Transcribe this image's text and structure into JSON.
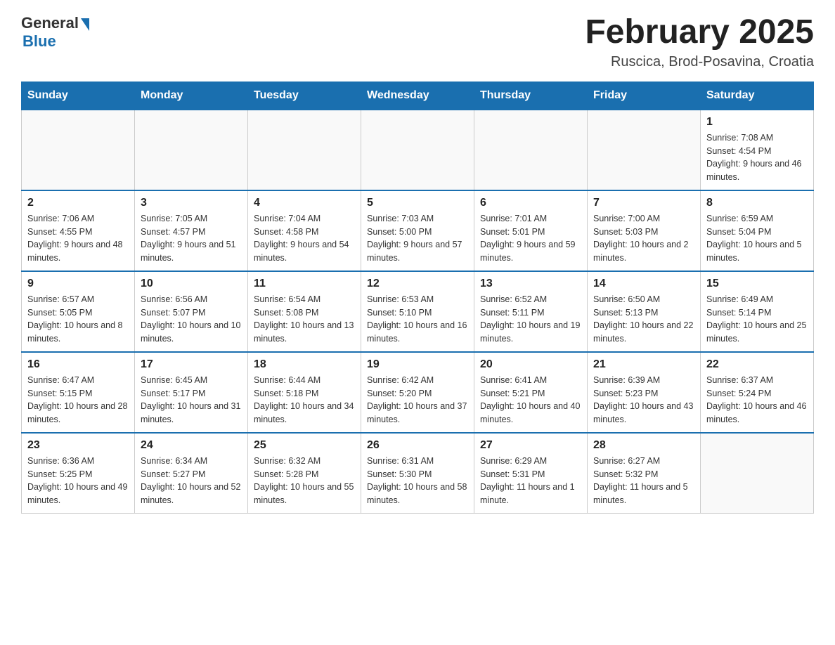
{
  "header": {
    "logo_general": "General",
    "logo_blue": "Blue",
    "month_title": "February 2025",
    "location": "Ruscica, Brod-Posavina, Croatia"
  },
  "days_of_week": [
    "Sunday",
    "Monday",
    "Tuesday",
    "Wednesday",
    "Thursday",
    "Friday",
    "Saturday"
  ],
  "weeks": [
    [
      {
        "day": "",
        "info": ""
      },
      {
        "day": "",
        "info": ""
      },
      {
        "day": "",
        "info": ""
      },
      {
        "day": "",
        "info": ""
      },
      {
        "day": "",
        "info": ""
      },
      {
        "day": "",
        "info": ""
      },
      {
        "day": "1",
        "info": "Sunrise: 7:08 AM\nSunset: 4:54 PM\nDaylight: 9 hours and 46 minutes."
      }
    ],
    [
      {
        "day": "2",
        "info": "Sunrise: 7:06 AM\nSunset: 4:55 PM\nDaylight: 9 hours and 48 minutes."
      },
      {
        "day": "3",
        "info": "Sunrise: 7:05 AM\nSunset: 4:57 PM\nDaylight: 9 hours and 51 minutes."
      },
      {
        "day": "4",
        "info": "Sunrise: 7:04 AM\nSunset: 4:58 PM\nDaylight: 9 hours and 54 minutes."
      },
      {
        "day": "5",
        "info": "Sunrise: 7:03 AM\nSunset: 5:00 PM\nDaylight: 9 hours and 57 minutes."
      },
      {
        "day": "6",
        "info": "Sunrise: 7:01 AM\nSunset: 5:01 PM\nDaylight: 9 hours and 59 minutes."
      },
      {
        "day": "7",
        "info": "Sunrise: 7:00 AM\nSunset: 5:03 PM\nDaylight: 10 hours and 2 minutes."
      },
      {
        "day": "8",
        "info": "Sunrise: 6:59 AM\nSunset: 5:04 PM\nDaylight: 10 hours and 5 minutes."
      }
    ],
    [
      {
        "day": "9",
        "info": "Sunrise: 6:57 AM\nSunset: 5:05 PM\nDaylight: 10 hours and 8 minutes."
      },
      {
        "day": "10",
        "info": "Sunrise: 6:56 AM\nSunset: 5:07 PM\nDaylight: 10 hours and 10 minutes."
      },
      {
        "day": "11",
        "info": "Sunrise: 6:54 AM\nSunset: 5:08 PM\nDaylight: 10 hours and 13 minutes."
      },
      {
        "day": "12",
        "info": "Sunrise: 6:53 AM\nSunset: 5:10 PM\nDaylight: 10 hours and 16 minutes."
      },
      {
        "day": "13",
        "info": "Sunrise: 6:52 AM\nSunset: 5:11 PM\nDaylight: 10 hours and 19 minutes."
      },
      {
        "day": "14",
        "info": "Sunrise: 6:50 AM\nSunset: 5:13 PM\nDaylight: 10 hours and 22 minutes."
      },
      {
        "day": "15",
        "info": "Sunrise: 6:49 AM\nSunset: 5:14 PM\nDaylight: 10 hours and 25 minutes."
      }
    ],
    [
      {
        "day": "16",
        "info": "Sunrise: 6:47 AM\nSunset: 5:15 PM\nDaylight: 10 hours and 28 minutes."
      },
      {
        "day": "17",
        "info": "Sunrise: 6:45 AM\nSunset: 5:17 PM\nDaylight: 10 hours and 31 minutes."
      },
      {
        "day": "18",
        "info": "Sunrise: 6:44 AM\nSunset: 5:18 PM\nDaylight: 10 hours and 34 minutes."
      },
      {
        "day": "19",
        "info": "Sunrise: 6:42 AM\nSunset: 5:20 PM\nDaylight: 10 hours and 37 minutes."
      },
      {
        "day": "20",
        "info": "Sunrise: 6:41 AM\nSunset: 5:21 PM\nDaylight: 10 hours and 40 minutes."
      },
      {
        "day": "21",
        "info": "Sunrise: 6:39 AM\nSunset: 5:23 PM\nDaylight: 10 hours and 43 minutes."
      },
      {
        "day": "22",
        "info": "Sunrise: 6:37 AM\nSunset: 5:24 PM\nDaylight: 10 hours and 46 minutes."
      }
    ],
    [
      {
        "day": "23",
        "info": "Sunrise: 6:36 AM\nSunset: 5:25 PM\nDaylight: 10 hours and 49 minutes."
      },
      {
        "day": "24",
        "info": "Sunrise: 6:34 AM\nSunset: 5:27 PM\nDaylight: 10 hours and 52 minutes."
      },
      {
        "day": "25",
        "info": "Sunrise: 6:32 AM\nSunset: 5:28 PM\nDaylight: 10 hours and 55 minutes."
      },
      {
        "day": "26",
        "info": "Sunrise: 6:31 AM\nSunset: 5:30 PM\nDaylight: 10 hours and 58 minutes."
      },
      {
        "day": "27",
        "info": "Sunrise: 6:29 AM\nSunset: 5:31 PM\nDaylight: 11 hours and 1 minute."
      },
      {
        "day": "28",
        "info": "Sunrise: 6:27 AM\nSunset: 5:32 PM\nDaylight: 11 hours and 5 minutes."
      },
      {
        "day": "",
        "info": ""
      }
    ]
  ]
}
